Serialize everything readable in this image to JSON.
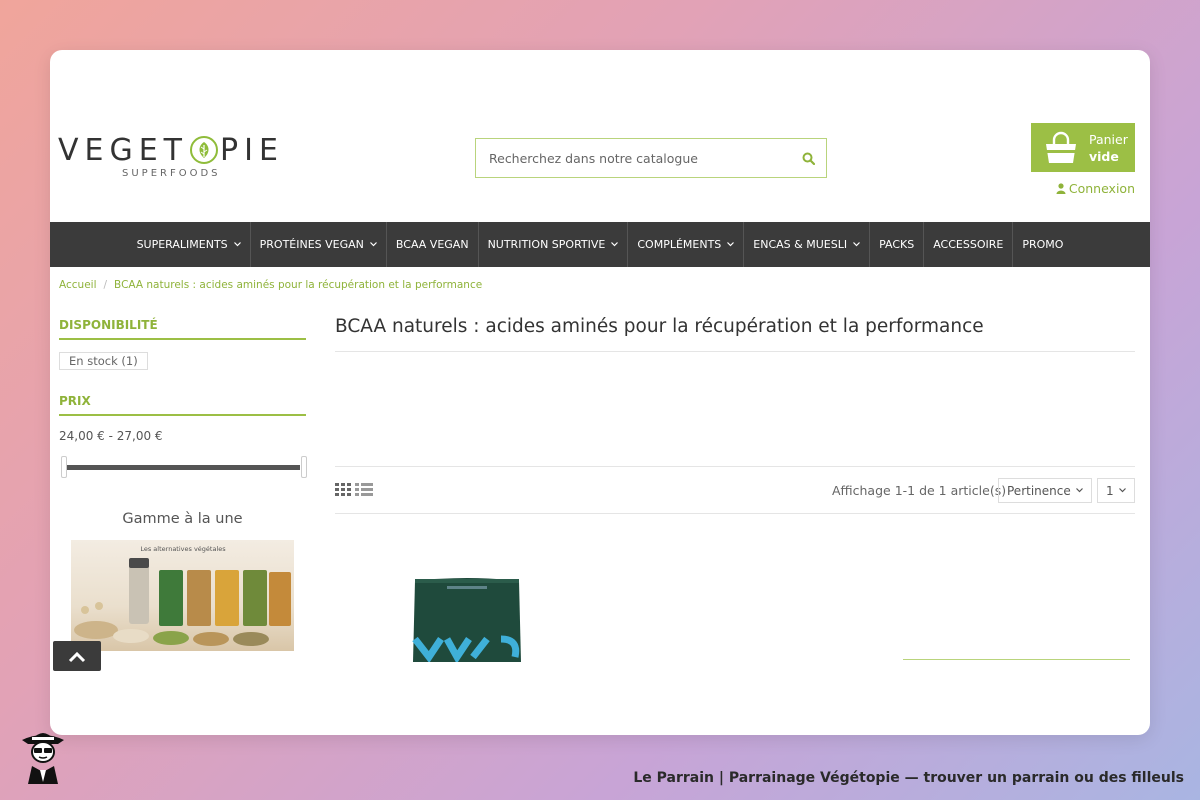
{
  "header": {
    "logo": {
      "word_before": "VEGET",
      "word_after": "PIE",
      "tagline": "SUPERFOODS"
    },
    "search": {
      "placeholder": "Recherchez dans notre catalogue",
      "icon": "search-icon"
    },
    "cart": {
      "label": "Panier",
      "status": "vide",
      "icon": "shopping-bag-icon"
    },
    "login": {
      "label": "Connexion",
      "icon": "user-icon"
    }
  },
  "nav": {
    "items": [
      {
        "label": "SUPERALIMENTS",
        "has_dropdown": true
      },
      {
        "label": "PROTÉINES VEGAN",
        "has_dropdown": true
      },
      {
        "label": "BCAA VEGAN",
        "has_dropdown": false
      },
      {
        "label": "NUTRITION SPORTIVE",
        "has_dropdown": true
      },
      {
        "label": "COMPLÉMENTS",
        "has_dropdown": true
      },
      {
        "label": "ENCAS & MUESLI",
        "has_dropdown": true
      },
      {
        "label": "PACKS",
        "has_dropdown": false
      },
      {
        "label": "ACCESSOIRE",
        "has_dropdown": false
      },
      {
        "label": "PROMO",
        "has_dropdown": false
      }
    ]
  },
  "breadcrumb": {
    "items": [
      "Accueil",
      "BCAA naturels : acides aminés pour la récupération et la performance"
    ],
    "separator": "/"
  },
  "sidebar": {
    "availability": {
      "title": "DISPONIBILITÉ",
      "option": "En stock (1)"
    },
    "price": {
      "title": "PRIX",
      "range": "24,00 € - 27,00 €"
    },
    "featured": {
      "title": "Gamme à la une",
      "image_caption": "Les alternatives végétales"
    }
  },
  "main": {
    "title": "BCAA naturels : acides aminés pour la récupération et la performance",
    "results_count": "Affichage 1-1 de 1 article(s)",
    "sort_selected": "Pertinence",
    "per_page_selected": "1"
  },
  "footer": {
    "text": "Le Parrain | Parrainage Végétopie — trouver un parrain ou des filleuls"
  },
  "colors": {
    "accent": "#9cbf45",
    "nav_bg": "#3b3b3b",
    "text": "#333333"
  }
}
